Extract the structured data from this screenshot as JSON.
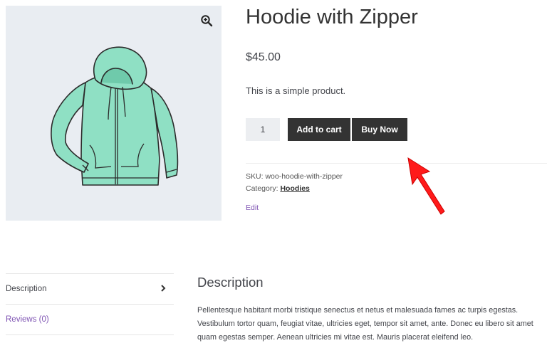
{
  "product": {
    "title": "Hoodie with Zipper",
    "price": "$45.00",
    "short_description": "This is a simple product.",
    "quantity": "1",
    "add_to_cart_label": "Add to cart",
    "buy_now_label": "Buy Now",
    "sku_label": "SKU:",
    "sku_value": "woo-hoodie-with-zipper",
    "category_label": "Category:",
    "category_value": "Hoodies",
    "edit_label": "Edit"
  },
  "gallery": {
    "zoom_icon": "zoom-in-icon",
    "image": "hoodie-product-image"
  },
  "annotation": {
    "arrow_color": "#ff1a1a"
  },
  "tabs": [
    {
      "label": "Description"
    },
    {
      "label": "Reviews (0)"
    }
  ],
  "description": {
    "heading": "Description",
    "text": "Pellentesque habitant morbi tristique senectus et netus et malesuada fames ac turpis egestas. Vestibulum tortor quam, feugiat vitae, ultricies eget, tempor sit amet, ante. Donec eu libero sit amet quam egestas semper. Aenean ultricies mi vitae est. Mauris placerat eleifend leo."
  },
  "colors": {
    "button_bg": "#333333",
    "link_purple": "#7f54b3",
    "gallery_bg": "#e9edf2",
    "hoodie_fill": "#8fe0c4"
  }
}
